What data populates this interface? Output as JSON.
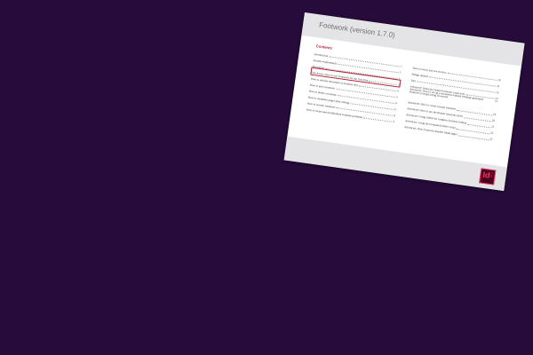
{
  "document": {
    "title": "Footwork (version 1.7.0)",
    "contents_heading": "Contents",
    "toc_left": [
      {
        "text": "Introduction",
        "page": "1"
      },
      {
        "text": "System requirements",
        "page": "1"
      },
      {
        "text": "Installation",
        "page": "1"
      },
      {
        "text": "Quickstart: How to use Footwork for the first time",
        "page": "2"
      },
      {
        "text": "How to edit the document or footnote text",
        "page": "5"
      },
      {
        "text": "How to add a footnote",
        "page": "5"
      },
      {
        "text": "How to delete a footnote",
        "page": "6"
      },
      {
        "text": "How to renumber pages after editing",
        "page": "6"
      },
      {
        "text": "How to reorder footnotes",
        "page": "8"
      },
      {
        "text": "How to locate and troubleshoot footnote problems",
        "page": "9"
      }
    ],
    "toc_right": [
      {
        "text": "How to resize and use fn-docs",
        "page": "10"
      },
      {
        "text": "Bridge options",
        "page": "11"
      },
      {
        "text": "Tips",
        "page": "12"
      },
      {
        "text": "Advanced: What the Detail/Footwork script does",
        "page": "13"
      },
      {
        "text": "Advanced: How to set up a document without Vellenge-generated footnotes to begin using Footwork",
        "page": "15"
      },
      {
        "text": "Advanced: How to create custom footnotes",
        "page": "18"
      },
      {
        "text": "Advanced: How to use the Reader insertion styles",
        "page": "20"
      },
      {
        "text": "Advanced: Using GREP for complex footnote formats",
        "page": "21"
      },
      {
        "text": "Advanced: Using the FootnoteUtilities script",
        "page": "22"
      },
      {
        "text": "Advanced: How Footwork handles blank pages",
        "page": "22"
      }
    ],
    "highlight_index": 3
  },
  "logo": {
    "letters": "Id",
    "badge": "CS6",
    "icon": "indesign-app-icon"
  },
  "colors": {
    "background": "#270b3a",
    "accent": "#b4243a",
    "logo_pink": "#ff3366"
  }
}
